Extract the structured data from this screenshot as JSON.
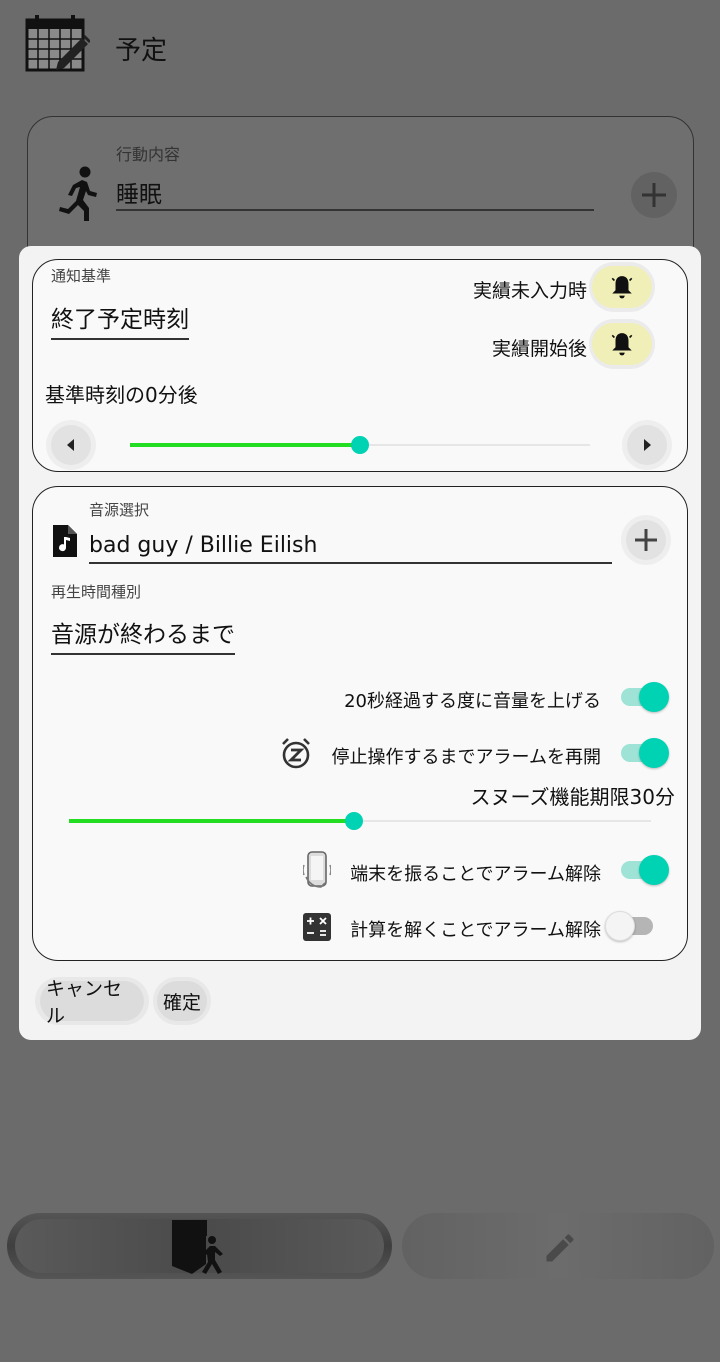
{
  "header": {
    "title": "予定",
    "icon": "calendar-edit-icon"
  },
  "background_card": {
    "label": "行動内容",
    "value": "睡眠",
    "icon": "running-person-icon"
  },
  "dialog": {
    "notify": {
      "label": "通知基準",
      "value": "終了予定時刻",
      "bell_rows": [
        {
          "label": "実績未入力時",
          "icon": "bell-icon"
        },
        {
          "label": "実績開始後",
          "icon": "bell-icon"
        }
      ],
      "offset_text": "基準時刻の0分後",
      "slider_fraction": 0.5
    },
    "sound": {
      "source_label": "音源選択",
      "source_value": "bad guy / Billie Eilish",
      "play_label": "再生時間種別",
      "play_value": "音源が終わるまで",
      "volume_label": "20秒経過する度に音量を上げる",
      "volume_on": true,
      "snooze_label": "停止操作するまでアラームを再開",
      "snooze_on": true,
      "snooze_limit": "スヌーズ機能期限30分",
      "snooze_slider_fraction": 0.49,
      "shake_label": "端末を振ることでアラーム解除",
      "shake_on": true,
      "calc_label": "計算を解くことでアラーム解除",
      "calc_on": false
    },
    "cancel_label": "キャンセル",
    "confirm_label": "確定"
  },
  "colors": {
    "accent": "#00d2b4",
    "slider_fill": "#22dd22",
    "bell_bg": "#f0efb8"
  }
}
